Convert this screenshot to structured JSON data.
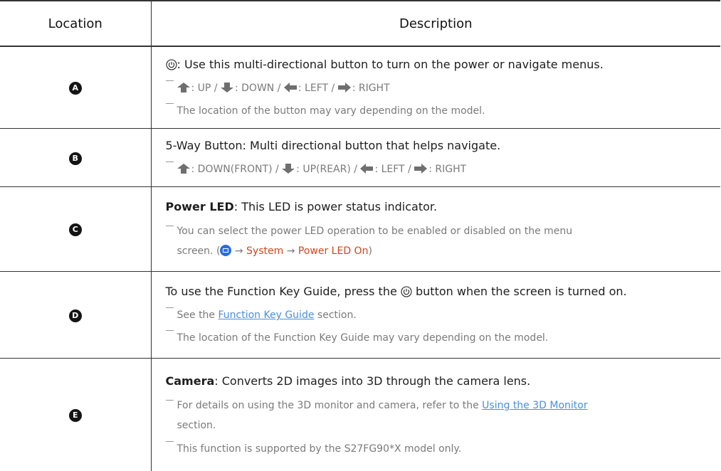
{
  "header": {
    "location": "Location",
    "description": "Description"
  },
  "rowA": {
    "badge": "A",
    "main_text": ": Use this multi-directional button to turn on the power or navigate menus.",
    "dir_up": ": UP /",
    "dir_down": ": DOWN /",
    "dir_left": ": LEFT /",
    "dir_right": ": RIGHT",
    "note2": "The location of the button may vary depending on the model."
  },
  "rowB": {
    "badge": "B",
    "main_text": "5-Way Button: Multi directional button that helps navigate.",
    "dir_up": ": DOWN(FRONT) /",
    "dir_down": ": UP(REAR) /",
    "dir_left": ": LEFT /",
    "dir_right": ": RIGHT"
  },
  "rowC": {
    "badge": "C",
    "term": "Power LED",
    "main_rest": ": This LED is power status indicator.",
    "note_line1": "You can select the power LED operation to be enabled or disabled on the menu",
    "note_prefix": "screen. (",
    "arrow1": "→",
    "menu_system": "System",
    "arrow2": "→",
    "menu_power_led": "Power LED On",
    "note_suffix": ")"
  },
  "rowD": {
    "badge": "D",
    "main_prefix": "To use the Function Key Guide, press the",
    "main_suffix": "button when the screen is turned on.",
    "note1_prefix": "See the",
    "note1_link": "Function Key Guide",
    "note1_suffix": "section.",
    "note2": "The location of the Function Key Guide may vary depending on the model."
  },
  "rowE": {
    "badge": "E",
    "term": "Camera",
    "main_rest": ": Converts 2D images into 3D through the camera lens.",
    "note1_prefix": "For details on using the 3D monitor and camera, refer to the",
    "note1_link": "Using the 3D Monitor",
    "note1_suffix": "section.",
    "note2": "This function is supported by the S27FG90*X model only."
  }
}
